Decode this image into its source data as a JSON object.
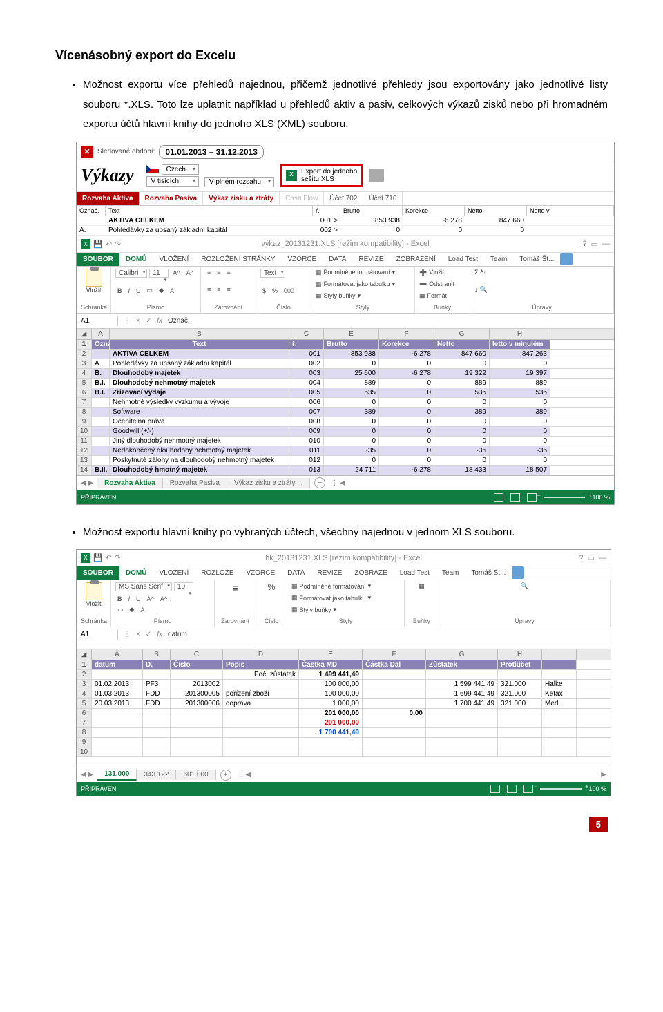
{
  "doc": {
    "title": "Vícenásobný export do Excelu",
    "bullet1": "Možnost exportu více přehledů najednou, přičemž jednotlivé přehledy jsou exportovány jako jednotlivé listy souboru *.XLS. Toto lze uplatnit například u přehledů aktiv a pasiv, celkových výkazů zisků nebo při hromadném exportu účtů hlavní knihy do jednoho XLS (XML) souboru.",
    "bullet2": "Možnost exportu hlavní knihy po vybraných účtech, všechny najednou v jednom XLS souboru.",
    "page_number": "5"
  },
  "vykazy": {
    "period_label": "Sledované období:",
    "period": "01.01.2013 – 31.12.2013",
    "logo": "Výkazy",
    "lang": "Czech",
    "scale": "V tisících",
    "scope": "V plném rozsahu",
    "export_btn_l1": "Export do jednoho",
    "export_btn_l2": "sešitu XLS",
    "tabs": [
      "Rozvaha Aktiva",
      "Rozvaha Pasiva",
      "Výkaz zisku a ztráty",
      "Cash Flow",
      "Účet 702",
      "Účet 710"
    ],
    "cols": [
      "Označ.",
      "Text",
      "ř.",
      "Brutto",
      "Korekce",
      "Netto",
      "Netto v"
    ],
    "rows": [
      {
        "oz": "",
        "txt": "AKTIVA CELKEM",
        "r": "001 >",
        "b": "853 938",
        "k": "-6 278",
        "n": "847 660",
        "nv": ""
      },
      {
        "oz": "A.",
        "txt": "Pohledávky za upsaný základní kapitál",
        "r": "002 >",
        "b": "0",
        "k": "0",
        "n": "0",
        "nv": ""
      }
    ]
  },
  "excel1": {
    "title": "výkaz_20131231.XLS [režim kompatibility] - Excel",
    "menu": [
      "SOUBOR",
      "DOMŮ",
      "VLOŽENÍ",
      "ROZLOŽENÍ STRÁNKY",
      "VZORCE",
      "DATA",
      "REVIZE",
      "ZOBRAZENÍ",
      "Load Test",
      "Team",
      "Tomáš Št..."
    ],
    "font": "Calibri",
    "fsize": "11",
    "groups": [
      "Schránka",
      "Písmo",
      "Zarovnání",
      "Číslo",
      "Styly",
      "Buňky",
      "Úpravy"
    ],
    "paste": "Vložit",
    "txt_fmt": "Text",
    "styly": [
      "Podmíněné formátování",
      "Formátovat jako tabulku",
      "Styly buňky"
    ],
    "bunky": [
      "Vložit",
      "Odstranit",
      "Formát"
    ],
    "namebox": "A1",
    "fx_val": "Označ.",
    "cols_let": [
      "A",
      "B",
      "C",
      "E",
      "F",
      "G",
      "H"
    ],
    "hdr": [
      "Označ.",
      "Text",
      "ř.",
      "Brutto",
      "Korekce",
      "Netto",
      "letto v minulém"
    ],
    "rows": [
      {
        "n": "2",
        "a": "",
        "b": "AKTIVA CELKEM",
        "c": "001",
        "e": "853 938",
        "f": "-6 278",
        "g": "847 660",
        "h": "847 263"
      },
      {
        "n": "3",
        "a": "A.",
        "b": "Pohledávky za upsaný základní kapitál",
        "c": "002",
        "e": "0",
        "f": "0",
        "g": "0",
        "h": "0"
      },
      {
        "n": "4",
        "a": "B.",
        "b": "Dlouhodobý majetek",
        "c": "003",
        "e": "25 600",
        "f": "-6 278",
        "g": "19 322",
        "h": "19 397"
      },
      {
        "n": "5",
        "a": "B.I.",
        "b": "Dlouhodobý nehmotný majetek",
        "c": "004",
        "e": "889",
        "f": "0",
        "g": "889",
        "h": "889"
      },
      {
        "n": "6",
        "a": "B.I.",
        "b": "Zřizovací výdaje",
        "c": "005",
        "e": "535",
        "f": "0",
        "g": "535",
        "h": "535"
      },
      {
        "n": "7",
        "a": "",
        "b": "Nehmotné výsledky výzkumu a vývoje",
        "c": "006",
        "e": "0",
        "f": "0",
        "g": "0",
        "h": "0"
      },
      {
        "n": "8",
        "a": "",
        "b": "Software",
        "c": "007",
        "e": "389",
        "f": "0",
        "g": "389",
        "h": "389"
      },
      {
        "n": "9",
        "a": "",
        "b": "Ocenitelná práva",
        "c": "008",
        "e": "0",
        "f": "0",
        "g": "0",
        "h": "0"
      },
      {
        "n": "10",
        "a": "",
        "b": "Goodwill (+/-)",
        "c": "009",
        "e": "0",
        "f": "0",
        "g": "0",
        "h": "0"
      },
      {
        "n": "11",
        "a": "",
        "b": "Jiný dlouhodobý nehmotný majetek",
        "c": "010",
        "e": "0",
        "f": "0",
        "g": "0",
        "h": "0"
      },
      {
        "n": "12",
        "a": "",
        "b": "Nedokončený dlouhodobý nehmotný majetek",
        "c": "011",
        "e": "-35",
        "f": "0",
        "g": "-35",
        "h": "-35"
      },
      {
        "n": "13",
        "a": "",
        "b": "Poskytnuté zálohy na dlouhodobý nehmotný majetek",
        "c": "012",
        "e": "0",
        "f": "0",
        "g": "0",
        "h": "0"
      },
      {
        "n": "14",
        "a": "B.II.",
        "b": "Dlouhodobý hmotný majetek",
        "c": "013",
        "e": "24 711",
        "f": "-6 278",
        "g": "18 433",
        "h": "18 507"
      }
    ],
    "sheets": [
      "Rozvaha Aktiva",
      "Rozvaha Pasiva",
      "Výkaz zisku a ztráty  ..."
    ],
    "status": "PŘIPRAVEN",
    "zoom": "100 %"
  },
  "excel2": {
    "title": "hk_20131231.XLS [režim kompatibility] - Excel",
    "menu": [
      "SOUBOR",
      "DOMŮ",
      "VLOŽENÍ",
      "ROZLOŽE",
      "VZORCE",
      "DATA",
      "REVIZE",
      "ZOBRAZE",
      "Load Test",
      "Team",
      "Tomáš Št..."
    ],
    "font": "MS Sans Serif",
    "fsize": "10",
    "groups": [
      "Schránka",
      "Písmo",
      "Zarovnání",
      "Číslo",
      "Styly",
      "Buňky",
      "Úpravy"
    ],
    "paste": "Vložit",
    "pct": "%",
    "styly": [
      "Podmíněné formátování",
      "Formátovat jako tabulku",
      "Styly buňky"
    ],
    "namebox": "A1",
    "fx_val": "datum",
    "cols_let": [
      "A",
      "B",
      "C",
      "D",
      "E",
      "F",
      "G",
      "H",
      ""
    ],
    "hdr": [
      "datum",
      "D.",
      "Číslo",
      "Popis",
      "Částka MD",
      "Částka Dal",
      "Zůstatek",
      "Protiúčet",
      ""
    ],
    "pocz_label": "Poč. zůstatek",
    "pocz_val": "1 499 441,49",
    "rows": [
      {
        "n": "3",
        "a": "01.02.2013",
        "b": "PF3",
        "c": "2013002",
        "d": "",
        "e": "100 000,00",
        "f": "",
        "g": "1 599 441,49",
        "h": "321.000",
        "i": "Halke"
      },
      {
        "n": "4",
        "a": "01.03.2013",
        "b": "FDD",
        "c": "201300005",
        "d": "pořízení zboží",
        "e": "100 000,00",
        "f": "",
        "g": "1 699 441,49",
        "h": "321.000",
        "i": "Ketax"
      },
      {
        "n": "5",
        "a": "20.03.2013",
        "b": "FDD",
        "c": "201300006",
        "d": "doprava",
        "e": "1 000,00",
        "f": "",
        "g": "1 700 441,49",
        "h": "321.000",
        "i": "Medi"
      }
    ],
    "sum_md": "201 000,00",
    "sum_dal": "0,00",
    "sum_red": "201 000,00",
    "sum_blue": "1 700 441,49",
    "sheets": [
      "131.000",
      "343.122",
      "601.000"
    ],
    "status": "PŘIPRAVEN",
    "zoom": "100 %"
  }
}
